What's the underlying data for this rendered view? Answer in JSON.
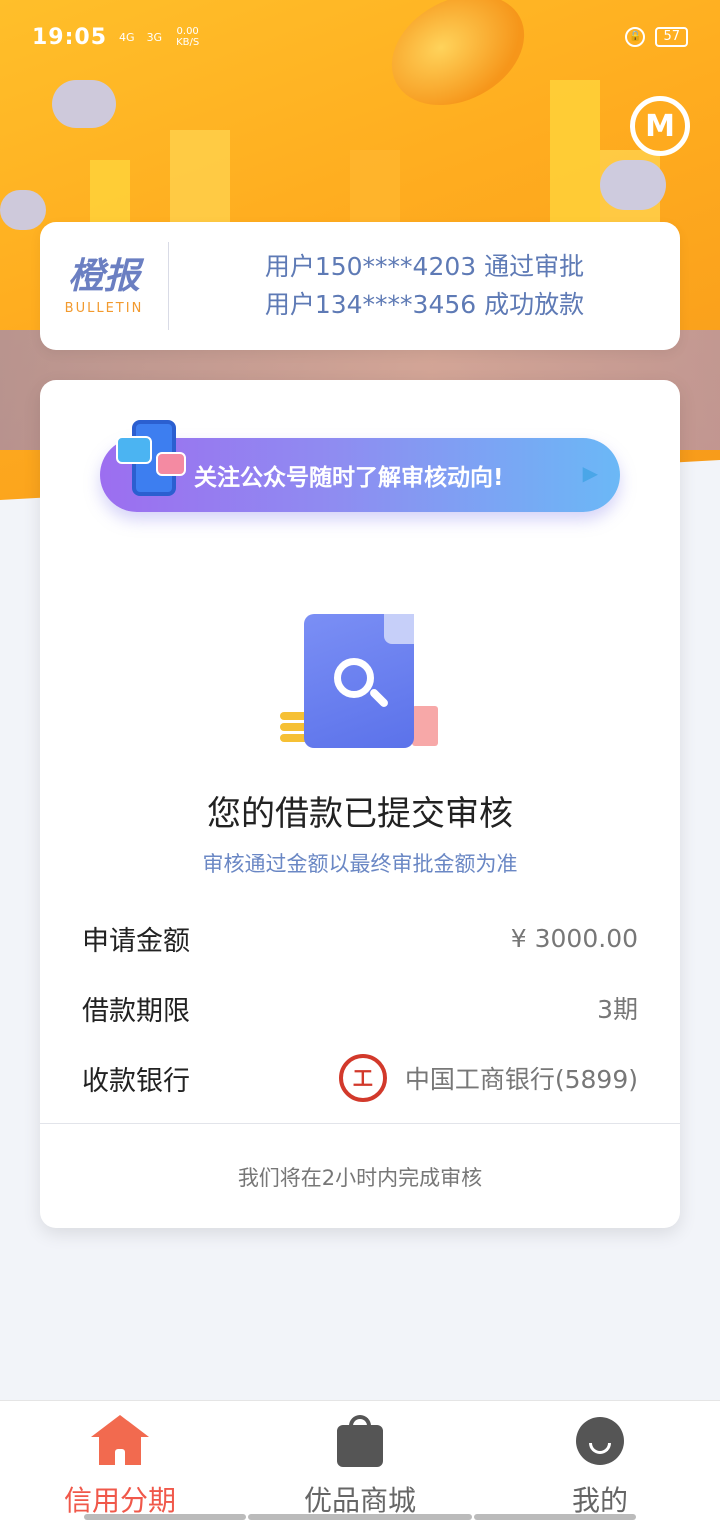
{
  "status_bar": {
    "time": "19:05",
    "signal_1": "4G",
    "signal_2": "3G",
    "net_speed": "0.00",
    "net_unit": "KB/S",
    "battery": "57"
  },
  "bulletin": {
    "brand_cn": "橙报",
    "brand_en": "BULLETIN",
    "messages": [
      "用户150****4203 通过审批",
      "用户134****3456 成功放款"
    ]
  },
  "banner": {
    "text": "关注公众号随时了解审核动向!"
  },
  "result": {
    "title": "您的借款已提交审核",
    "subtitle": "审核通过金额以最终审批金额为准"
  },
  "details": {
    "amount_label": "申请金额",
    "amount_value": "¥ 3000.00",
    "term_label": "借款期限",
    "term_value": "3期",
    "bank_label": "收款银行",
    "bank_value": "中国工商银行(5899)"
  },
  "footnote": "我们将在2小时内完成审核",
  "tabs": [
    {
      "label": "信用分期",
      "icon": "home-icon",
      "active": true
    },
    {
      "label": "优品商城",
      "icon": "shopping-bag-icon",
      "active": false
    },
    {
      "label": "我的",
      "icon": "profile-icon",
      "active": false
    }
  ],
  "colors": {
    "hero": "#ffb223",
    "accent": "#f0584a",
    "banner_start": "#9c6ef0",
    "banner_end": "#6bb8f6",
    "bank_red": "#d2392b"
  }
}
